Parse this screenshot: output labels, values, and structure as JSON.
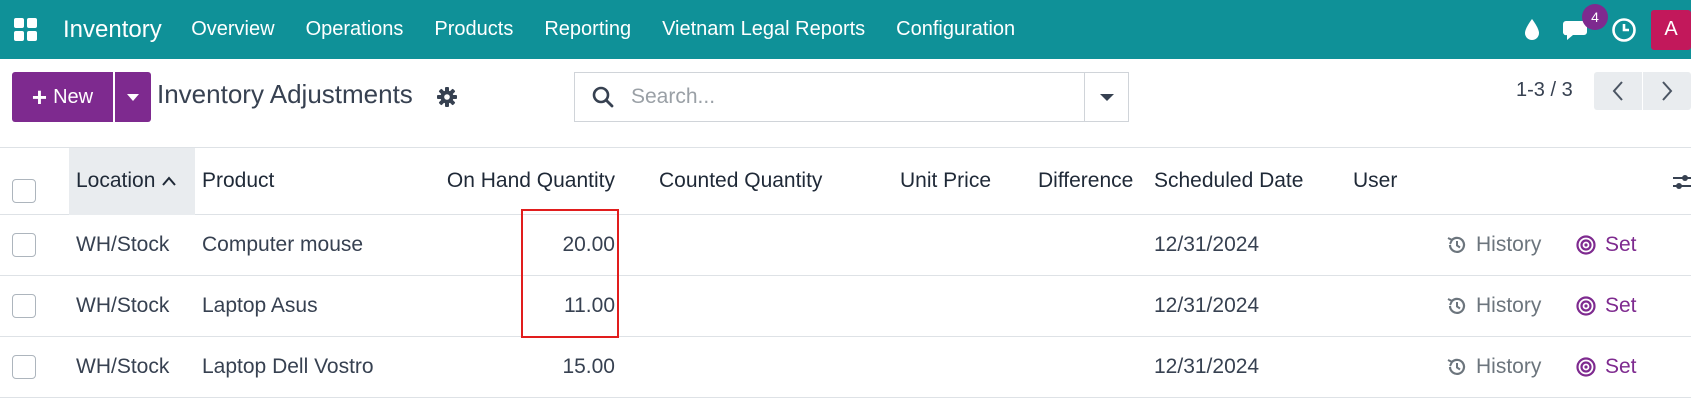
{
  "navbar": {
    "app_name": "Inventory",
    "menu": [
      "Overview",
      "Operations",
      "Products",
      "Reporting",
      "Vietnam Legal Reports",
      "Configuration"
    ],
    "messages_count": "4",
    "avatar_initial": "A"
  },
  "control": {
    "new_label": "New",
    "title": "Inventory Adjustments",
    "search_placeholder": "Search...",
    "pager": "1-3 / 3"
  },
  "table": {
    "columns": [
      "Location",
      "Product",
      "On Hand Quantity",
      "Counted Quantity",
      "Unit Price",
      "Difference",
      "Scheduled Date",
      "User"
    ],
    "sort_column": "Location",
    "rows": [
      {
        "location": "WH/Stock",
        "product": "Computer mouse",
        "on_hand": "20.00",
        "counted": "",
        "unit_price": "",
        "difference": "",
        "scheduled_date": "12/31/2024",
        "user": ""
      },
      {
        "location": "WH/Stock",
        "product": "Laptop Asus",
        "on_hand": "11.00",
        "counted": "",
        "unit_price": "",
        "difference": "",
        "scheduled_date": "12/31/2024",
        "user": ""
      },
      {
        "location": "WH/Stock",
        "product": "Laptop Dell Vostro",
        "on_hand": "15.00",
        "counted": "",
        "unit_price": "",
        "difference": "",
        "scheduled_date": "12/31/2024",
        "user": ""
      }
    ],
    "actions": {
      "history": "History",
      "set": "Set"
    }
  },
  "colors": {
    "navbar": "#0f9198",
    "primary": "#7e2a8f",
    "highlight": "#e11d1d"
  },
  "icons": {
    "apps": "apps-grid-icon",
    "drop": "water-drop-icon",
    "chat": "chat-icon",
    "clock": "clock-icon",
    "gear": "gear-icon",
    "search": "search-icon",
    "history": "history-icon",
    "set": "target-icon"
  }
}
